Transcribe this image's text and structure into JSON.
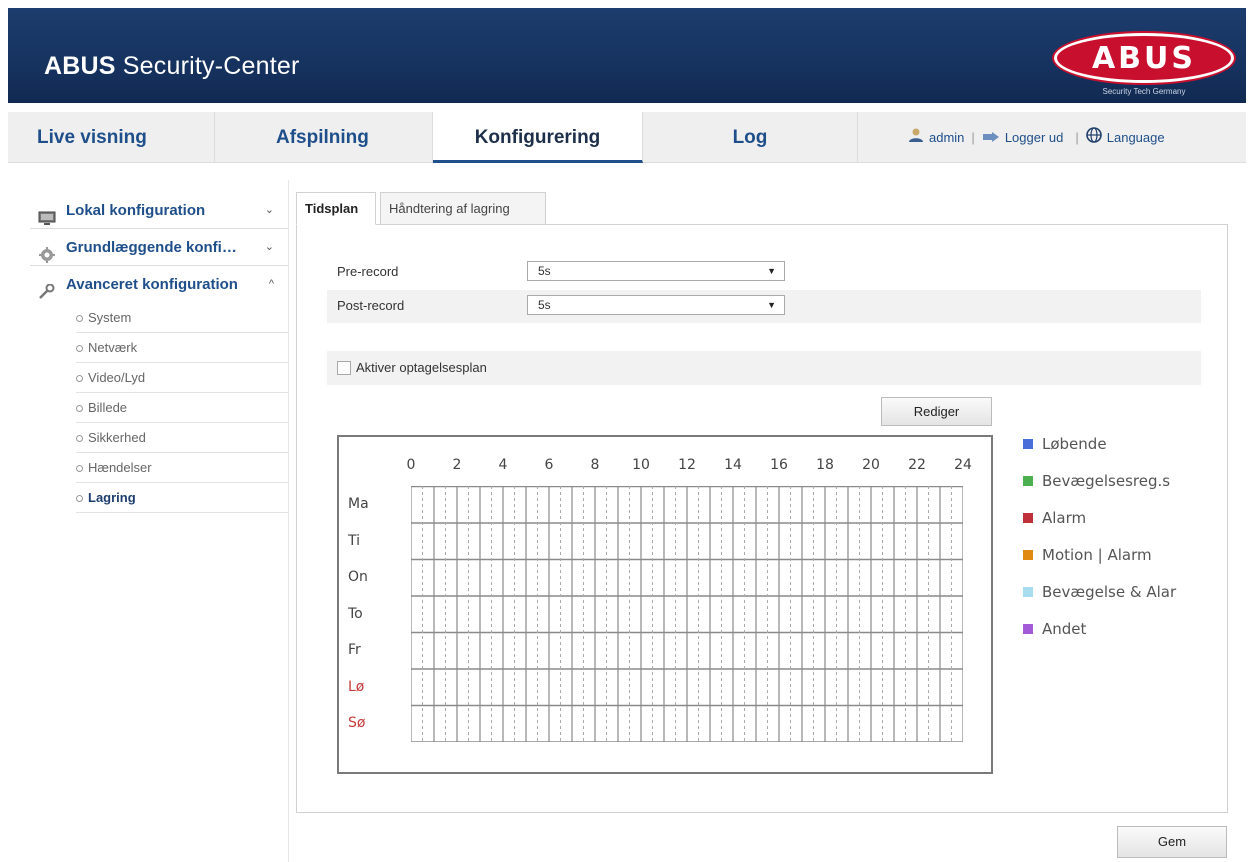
{
  "header": {
    "title_bold": "ABUS",
    "title_rest": "Security-Center",
    "logo_text": "ABUS",
    "logo_sub": "Security Tech Germany"
  },
  "nav": {
    "tabs": [
      {
        "label": "Live visning",
        "active": false
      },
      {
        "label": "Afspilning",
        "active": false
      },
      {
        "label": "Konfigurering",
        "active": true
      },
      {
        "label": "Log",
        "active": false
      }
    ],
    "user": "admin",
    "logout": "Logger ud",
    "language": "Language"
  },
  "sidebar": {
    "sections": [
      {
        "label": "Lokal konfiguration",
        "chevron": "⌄"
      },
      {
        "label": "Grundlæggende konfi…",
        "chevron": "⌄"
      },
      {
        "label": "Avanceret konfiguration",
        "chevron": "^"
      }
    ],
    "items": [
      {
        "label": "System"
      },
      {
        "label": "Netværk"
      },
      {
        "label": "Video/Lyd"
      },
      {
        "label": "Billede"
      },
      {
        "label": "Sikkerhed"
      },
      {
        "label": "Hændelser"
      },
      {
        "label": "Lagring",
        "active": true
      }
    ]
  },
  "tabs": [
    {
      "label": "Tidsplan",
      "active": true
    },
    {
      "label": "Håndtering af lagring",
      "active": false
    }
  ],
  "form": {
    "pre_record": {
      "label": "Pre-record",
      "value": "5s"
    },
    "post_record": {
      "label": "Post-record",
      "value": "5s"
    },
    "enable_schedule": {
      "label": "Aktiver optagelsesplan",
      "checked": false
    }
  },
  "buttons": {
    "edit": "Rediger",
    "save": "Gem"
  },
  "schedule": {
    "hours": [
      "0",
      "2",
      "4",
      "6",
      "8",
      "10",
      "12",
      "14",
      "16",
      "18",
      "20",
      "22",
      "24"
    ],
    "days": [
      {
        "label": "Ma",
        "weekend": false
      },
      {
        "label": "Ti",
        "weekend": false
      },
      {
        "label": "On",
        "weekend": false
      },
      {
        "label": "To",
        "weekend": false
      },
      {
        "label": "Fr",
        "weekend": false
      },
      {
        "label": "Lø",
        "weekend": true
      },
      {
        "label": "Sø",
        "weekend": true
      }
    ]
  },
  "legend": [
    {
      "label": "Løbende",
      "color": "#4a6fd8"
    },
    {
      "label": "Bevægelsesreg.s",
      "color": "#4caf50"
    },
    {
      "label": "Alarm",
      "color": "#c0303a"
    },
    {
      "label": "Motion | Alarm",
      "color": "#e08a12"
    },
    {
      "label": "Bevægelse & Alar",
      "color": "#a8dcef"
    },
    {
      "label": "Andet",
      "color": "#a35ad8"
    }
  ],
  "colors": {
    "header_bg": "#16325f",
    "accent": "#1f4f8a",
    "weekend": "#c43c3c",
    "logo": "#c8102e"
  }
}
